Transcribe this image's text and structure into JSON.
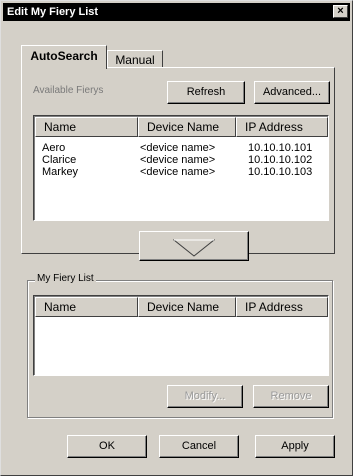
{
  "window": {
    "title": "Edit My Fiery List",
    "close_glyph": "×"
  },
  "tabs": [
    {
      "label": "AutoSearch",
      "active": true
    },
    {
      "label": "Manual",
      "active": false
    }
  ],
  "available": {
    "label": "Available Fierys",
    "refresh_label": "Refresh",
    "advanced_label": "Advanced...",
    "columns": [
      "Name",
      "Device Name",
      "IP Address"
    ],
    "rows": [
      [
        "Aero",
        "<device name>",
        "10.10.10.101"
      ],
      [
        "Clarice",
        "<device name>",
        "10.10.10.102"
      ],
      [
        "Markey",
        "<device name>",
        "10.10.10.103"
      ]
    ],
    "add_icon": "down-arrow-icon"
  },
  "my_list": {
    "label": "My Fiery List",
    "columns": [
      "Name",
      "Device Name",
      "IP Address"
    ],
    "rows": [],
    "modify_label": "Modify...",
    "remove_label": "Remove"
  },
  "footer": {
    "ok_label": "OK",
    "cancel_label": "Cancel",
    "apply_label": "Apply"
  }
}
